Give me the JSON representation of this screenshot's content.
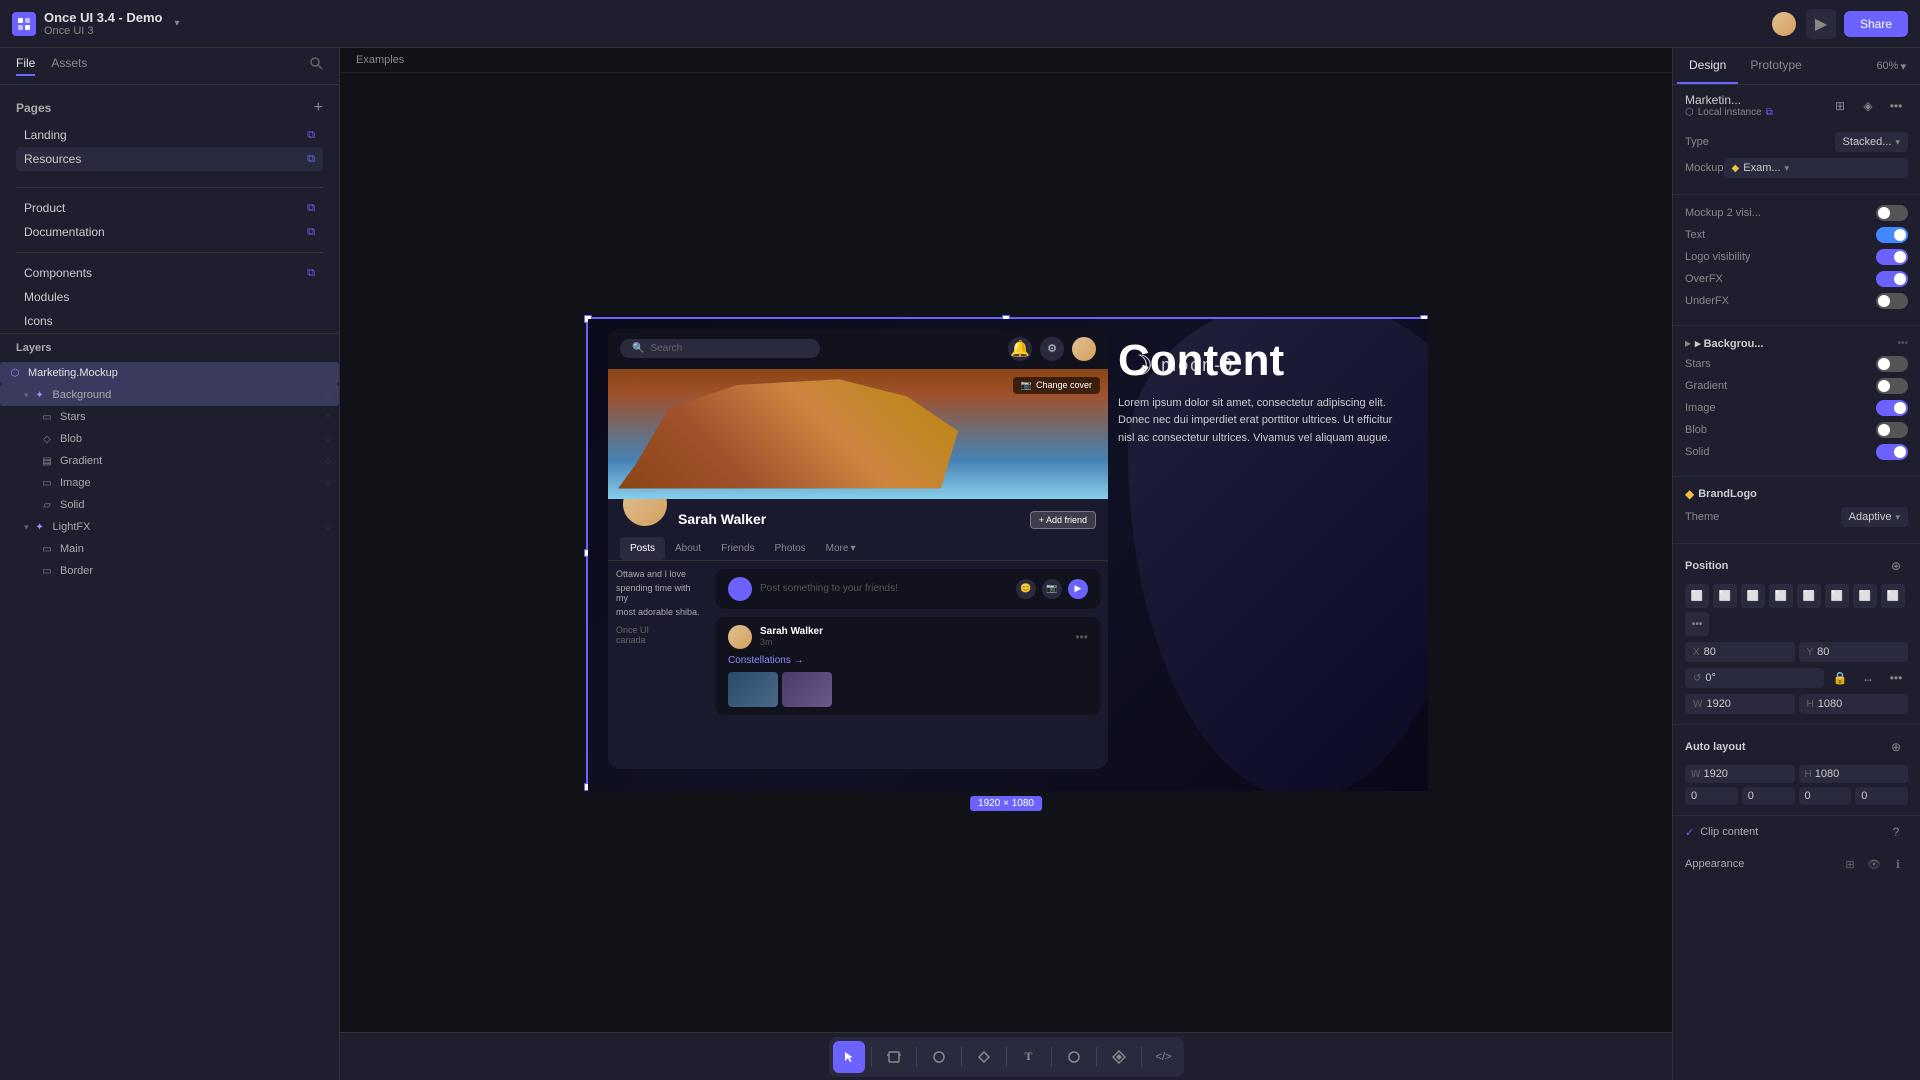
{
  "app": {
    "title": "Once UI 3.4 - Demo",
    "subtitle": "Once UI 3",
    "play_btn": "▶",
    "share_btn": "Share"
  },
  "sidebar": {
    "file_tab": "File",
    "assets_tab": "Assets",
    "pages_title": "Pages",
    "pages": [
      {
        "name": "Landing",
        "link": "⧉"
      },
      {
        "name": "Resources",
        "link": "⧉"
      }
    ],
    "nav_items": [
      {
        "name": "Product",
        "link": "⧉"
      },
      {
        "name": "Documentation",
        "link": "⧉"
      }
    ],
    "sections": [
      {
        "name": "Components",
        "link": "⧉"
      },
      {
        "name": "Modules"
      },
      {
        "name": "Icons"
      }
    ]
  },
  "layers": {
    "title": "Layers",
    "items": [
      {
        "name": "Marketing.Mockup",
        "indent": 0,
        "icon": "⬡",
        "selected": true
      },
      {
        "name": "Background",
        "indent": 1,
        "icon": "✦",
        "toggle": "◌"
      },
      {
        "name": "Stars",
        "indent": 2,
        "icon": "▭",
        "toggle": "◌"
      },
      {
        "name": "Blob",
        "indent": 2,
        "icon": "◇",
        "toggle": "◌"
      },
      {
        "name": "Gradient",
        "indent": 2,
        "icon": "▤",
        "toggle": "◌"
      },
      {
        "name": "Image",
        "indent": 2,
        "icon": "▭",
        "toggle": "◌"
      },
      {
        "name": "Solid",
        "indent": 2,
        "icon": "▱"
      },
      {
        "name": "LightFX",
        "indent": 1,
        "icon": "✦",
        "toggle": "◌"
      },
      {
        "name": "Main",
        "indent": 2,
        "icon": "▭"
      },
      {
        "name": "Border",
        "indent": 2,
        "icon": "▭"
      }
    ]
  },
  "canvas": {
    "breadcrumb": "Examples",
    "frame_size": "1920 × 1080"
  },
  "right_panel": {
    "design_tab": "Design",
    "prototype_tab": "Prototype",
    "zoom": "60%",
    "component_name": "Marketin...",
    "local_instance": "Local instance",
    "type_label": "Type",
    "type_value": "Stacked...",
    "mockup_label": "Mockup",
    "mockup_value": "Exam...",
    "mockup2_label": "Mockup 2 visi...",
    "text_label": "Text",
    "logo_label": "Logo visibility",
    "overfx_label": "OverFX",
    "underfx_label": "UnderFX",
    "background_label": "▸ Backgrou...",
    "stars_label": "Stars",
    "gradient_label": "Gradient",
    "image_label": "Image",
    "blob_label": "Blob",
    "solid_label": "Solid",
    "brand_logo": "BrandLogo",
    "theme_label": "Theme",
    "theme_value": "Adaptive",
    "position_label": "Position",
    "x_label": "X",
    "x_value": "80",
    "y_label": "Y",
    "y_value": "80",
    "rotation_label": "0°",
    "w_label": "W",
    "w_value": "1920",
    "h_label": "H",
    "h_value": "1080",
    "autolayout_label": "Auto layout",
    "clip_content": "Clip content",
    "appearance_label": "Appearance"
  },
  "mockup": {
    "search_placeholder": "Search",
    "cover_btn": "Change cover",
    "profile_name": "Sarah Walker",
    "add_friend": "+ Add friend",
    "tabs": [
      "Posts",
      "About",
      "Friends",
      "Photos",
      "More"
    ],
    "post_placeholder": "Post something to your friends!",
    "feed_user": "Sarah Walker",
    "feed_time": "3m",
    "feed_link": "Constellations →",
    "content_title": "Content",
    "content_body": "Lorem ipsum dolor sit amet, consectetur adipiscing elit. Donec nec dui imperdiet erat porttitor ultrices. Ut efficitur nisl ac consectetur ultrices. Vivamus vel aliquam augue.",
    "moon_text": "moon-0"
  },
  "toolbar": {
    "tools": [
      "▲",
      "⊞",
      "○",
      "⬡",
      "T",
      "◯",
      "✦",
      "</>"
    ]
  }
}
